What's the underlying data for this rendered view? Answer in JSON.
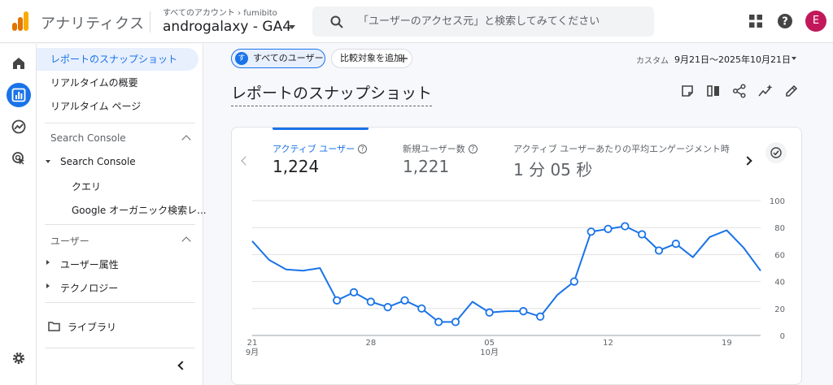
{
  "header": {
    "app_name": "アナリティクス",
    "account_crumb": "すべてのアカウント › fumibito",
    "property": "androgalaxy - GA4",
    "search_placeholder": "「ユーザーのアクセス元」と検索してみてください",
    "avatar_letter": "E",
    "brand_color": "#f9ab00"
  },
  "nav": {
    "items": [
      {
        "label": "レポートのスナップショット"
      },
      {
        "label": "リアルタイムの概要"
      },
      {
        "label": "リアルタイム ページ"
      }
    ],
    "section1": "Search Console",
    "section1_group": "Search Console",
    "section1_children": [
      "クエリ",
      "Google オーガニック検索レ..."
    ],
    "section2": "ユーザー",
    "section2_groups": [
      "ユーザー属性",
      "テクノロジー"
    ],
    "library": "ライブラリ"
  },
  "filters": {
    "users_chip_badge": "す",
    "users_chip": "すべてのユーザー",
    "compare_chip": "比較対象を追加",
    "date_label": "カスタム",
    "date_range": "9月21日～2025年10月21日"
  },
  "page": {
    "title": "レポートのスナップショット"
  },
  "metrics": [
    {
      "label": "アクティブ ユーザー",
      "value": "1,224"
    },
    {
      "label": "新規ユーザー数",
      "value": "1,221"
    },
    {
      "label": "アクティブ ユーザーあたりの平均エンゲージメント時",
      "value": "1 分 05 秒"
    }
  ],
  "chart_data": {
    "type": "line",
    "xlabel": "",
    "ylabel": "",
    "x": [
      "9/21",
      "9/22",
      "9/23",
      "9/24",
      "9/25",
      "9/26",
      "9/27",
      "9/28",
      "9/29",
      "9/30",
      "10/01",
      "10/02",
      "10/03",
      "10/04",
      "10/05",
      "10/06",
      "10/07",
      "10/08",
      "10/09",
      "10/10",
      "10/11",
      "10/12",
      "10/13",
      "10/14",
      "10/15",
      "10/16",
      "10/17",
      "10/18",
      "10/19",
      "10/20",
      "10/21"
    ],
    "values": [
      70,
      56,
      49,
      48,
      50,
      26,
      32,
      25,
      21,
      26,
      20,
      10,
      10,
      25,
      17,
      18,
      18,
      14,
      30,
      40,
      77,
      79,
      81,
      75,
      63,
      68,
      58,
      73,
      78,
      65,
      48
    ],
    "highlighted_indices": [
      5,
      6,
      7,
      8,
      9,
      10,
      11,
      12,
      14,
      16,
      17,
      19,
      20,
      21,
      22,
      23,
      24,
      25
    ],
    "ylim": [
      0,
      100
    ],
    "yticks": [
      "0",
      "20",
      "40",
      "60",
      "80",
      "100"
    ],
    "xticks": [
      {
        "index": 0,
        "day": "21",
        "month": "9月"
      },
      {
        "index": 7,
        "day": "28",
        "month": ""
      },
      {
        "index": 14,
        "day": "05",
        "month": "10月"
      },
      {
        "index": 21,
        "day": "12",
        "month": ""
      },
      {
        "index": 28,
        "day": "19",
        "month": ""
      }
    ],
    "grid": true,
    "color": "#1a73e8"
  }
}
